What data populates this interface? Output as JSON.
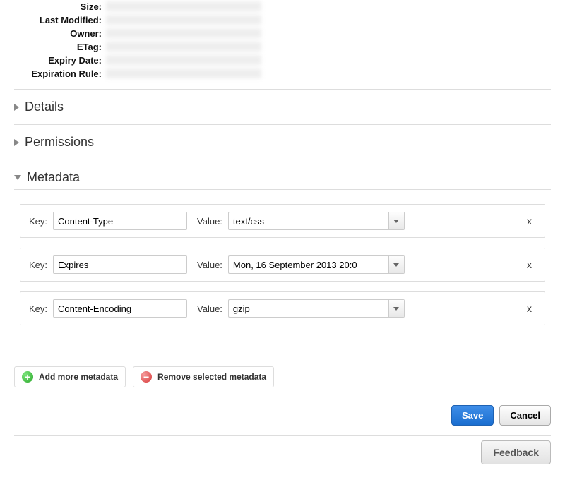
{
  "props": {
    "size_label": "Size:",
    "last_modified_label": "Last Modified:",
    "owner_label": "Owner:",
    "etag_label": "ETag:",
    "expiry_date_label": "Expiry Date:",
    "expiration_rule_label": "Expiration Rule:"
  },
  "sections": {
    "details": "Details",
    "permissions": "Permissions",
    "metadata": "Metadata"
  },
  "meta_labels": {
    "key": "Key:",
    "value": "Value:",
    "remove_row": "x"
  },
  "metadata_rows": [
    {
      "key": "Content-Type",
      "value": "text/css"
    },
    {
      "key": "Expires",
      "value": "Mon, 16 September 2013 20:0"
    },
    {
      "key": "Content-Encoding",
      "value": "gzip"
    }
  ],
  "actions": {
    "add_more": "Add more metadata",
    "remove_selected": "Remove selected metadata"
  },
  "footer": {
    "save": "Save",
    "cancel": "Cancel",
    "feedback": "Feedback"
  },
  "icons": {
    "plus": "+",
    "minus": "−"
  }
}
